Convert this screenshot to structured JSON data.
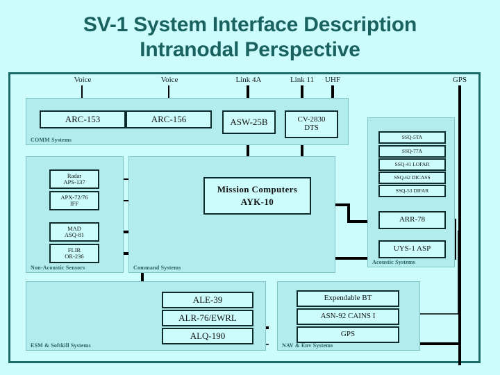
{
  "title": {
    "line1": "SV-1 System Interface Description",
    "line2": "Intranodal Perspective"
  },
  "colors": {
    "background": "#ccfcfc",
    "title_text": "#1a6260",
    "frame_border": "#1d6b69",
    "panel_fill": "#b3ecec",
    "panel_border": "#7fc4c4",
    "box_fill": "#ccfcfc",
    "box_border": "#0d2b2b",
    "wire": "#000000"
  },
  "external_interfaces": [
    {
      "label": "Voice",
      "id": "voice-1"
    },
    {
      "label": "Voice",
      "id": "voice-2"
    },
    {
      "label": "Link 4A",
      "id": "link-4a"
    },
    {
      "label": "Link 11",
      "id": "link-11"
    },
    {
      "label": "UHF",
      "id": "uhf"
    },
    {
      "label": "GPS",
      "id": "gps-ext"
    }
  ],
  "panels": [
    {
      "id": "comm-systems",
      "label": "COMM Systems",
      "boxes": [
        {
          "id": "arc-153",
          "line1": "ARC-153",
          "line2": ""
        },
        {
          "id": "arc-156",
          "line1": "ARC-156",
          "line2": ""
        },
        {
          "id": "asw-25b",
          "line1": "ASW-25B",
          "line2": ""
        },
        {
          "id": "cv-2830",
          "line1": "CV-2830",
          "line2": "DTS"
        }
      ]
    },
    {
      "id": "non-acoustic-sensors",
      "label": "Non-Acoustic Sensors",
      "boxes": [
        {
          "id": "radar-aps-137",
          "line1": "Radar",
          "line2": "APS-137"
        },
        {
          "id": "apx-72-76-iff",
          "line1": "APX-72/76",
          "line2": "IFF"
        },
        {
          "id": "mad-asq-81",
          "line1": "MAD",
          "line2": "ASQ-81"
        },
        {
          "id": "flir-or-236",
          "line1": "FLIR",
          "line2": "OR-236"
        }
      ]
    },
    {
      "id": "command-systems",
      "label": "Command Systems",
      "boxes": [
        {
          "id": "mission-computers",
          "line1": "Mission Computers",
          "line2": "AYK-10"
        }
      ]
    },
    {
      "id": "acoustic-systems",
      "label": "Acoustic Systems",
      "boxes": [
        {
          "id": "ssq-5ta",
          "line1": "SSQ-5TA",
          "line2": ""
        },
        {
          "id": "ssq-77a",
          "line1": "SSQ-77A",
          "line2": ""
        },
        {
          "id": "ssq-41-lofar",
          "line1": "SSQ-41 LOFAR",
          "line2": ""
        },
        {
          "id": "ssq-62-dicass",
          "line1": "SSQ-62 DICASS",
          "line2": ""
        },
        {
          "id": "ssq-53-difar",
          "line1": "SSQ-53 DIFAR",
          "line2": ""
        },
        {
          "id": "arr-78",
          "line1": "ARR-78",
          "line2": ""
        },
        {
          "id": "uys-1-asp",
          "line1": "UYS-1 ASP",
          "line2": ""
        }
      ]
    },
    {
      "id": "esm-softkill-systems",
      "label": "ESM & Softkill Systems",
      "boxes": [
        {
          "id": "ale-39",
          "line1": "ALE-39",
          "line2": ""
        },
        {
          "id": "alr-76-ewrl",
          "line1": "ALR-76/EWRL",
          "line2": ""
        },
        {
          "id": "alq-190",
          "line1": "ALQ-190",
          "line2": ""
        }
      ]
    },
    {
      "id": "nav-env-systems",
      "label": "NAV & Env Systems",
      "boxes": [
        {
          "id": "expendable-bt",
          "line1": "Expendable BT",
          "line2": ""
        },
        {
          "id": "asn-92-cains-1",
          "line1": "ASN-92 CAINS I",
          "line2": ""
        },
        {
          "id": "gps",
          "line1": "GPS",
          "line2": ""
        }
      ]
    }
  ]
}
